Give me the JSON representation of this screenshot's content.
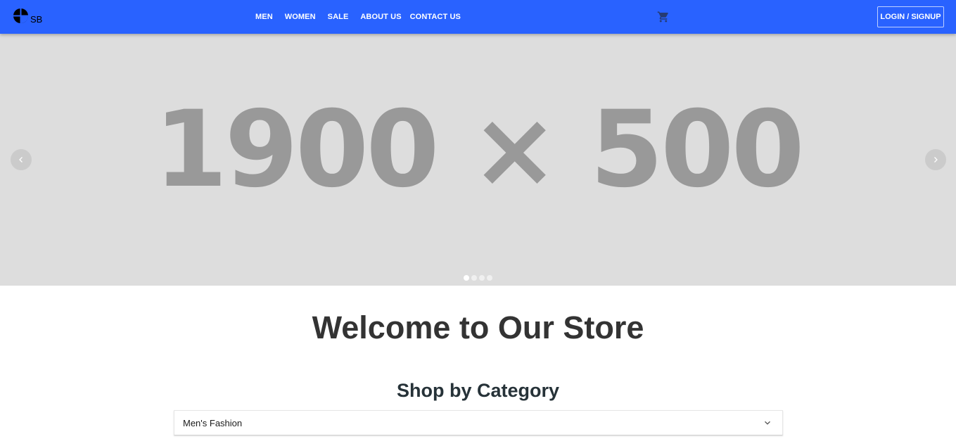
{
  "header": {
    "logo_text": "SB",
    "nav_links": [
      {
        "label": "MEN"
      },
      {
        "label": "WOMEN"
      },
      {
        "label": "SALE"
      },
      {
        "label": "ABOUT US"
      },
      {
        "label": "CONTACT US"
      }
    ],
    "cart_icon": "shopping-cart-icon",
    "login_label": "LOGIN / SIGNUP"
  },
  "carousel": {
    "slide_text": "1900 × 500",
    "slide_count": 4,
    "active_slide": 1,
    "prev_icon": "chevron-left-icon",
    "next_icon": "chevron-right-icon"
  },
  "main": {
    "welcome_title": "Welcome to Our Store",
    "category_heading": "Shop by Category",
    "categories": [
      {
        "label": "Men's Fashion",
        "expanded": false
      }
    ]
  },
  "colors": {
    "navbar": "#2962ff",
    "carousel_bg": "#dddddd",
    "placeholder_text": "#999999",
    "heading_text": "#333333"
  }
}
